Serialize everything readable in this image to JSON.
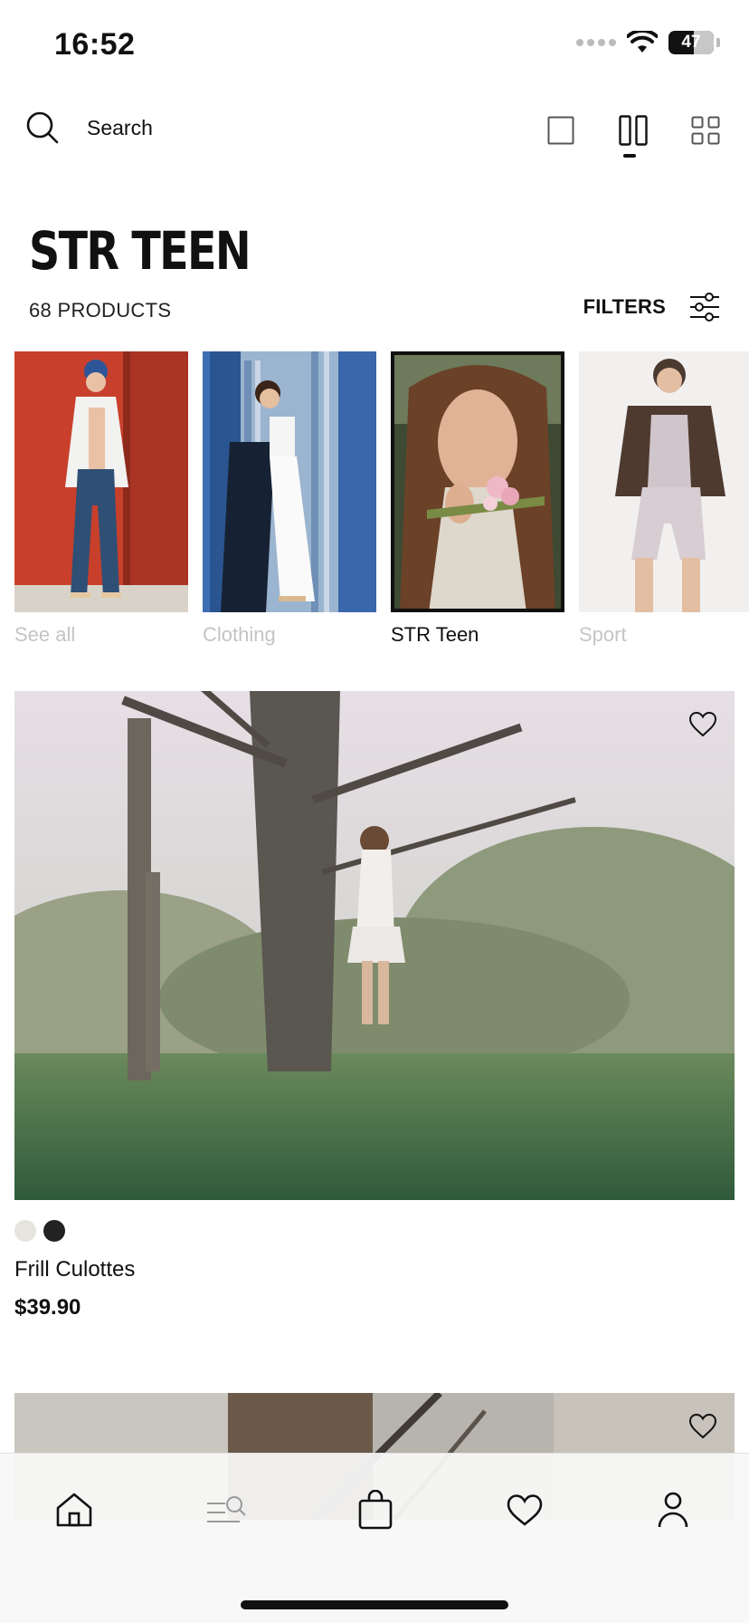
{
  "status_bar": {
    "time": "16:52",
    "battery": "47"
  },
  "search": {
    "label": "Search"
  },
  "view_options": [
    "single-column",
    "two-column",
    "grid"
  ],
  "header": {
    "title": "STR TEEN",
    "count": "68 PRODUCTS",
    "filters_label": "FILTERS"
  },
  "categories": [
    {
      "label": "See all",
      "active": false
    },
    {
      "label": "Clothing",
      "active": false
    },
    {
      "label": "STR Teen",
      "active": true
    },
    {
      "label": "Sport",
      "active": false
    }
  ],
  "product": {
    "name": "Frill Culottes",
    "price": "$39.90",
    "colors": [
      "#e6e4df",
      "#222222"
    ]
  },
  "bottom_nav": [
    "home-icon",
    "search-menu-icon",
    "bag-icon",
    "heart-icon",
    "profile-icon"
  ]
}
